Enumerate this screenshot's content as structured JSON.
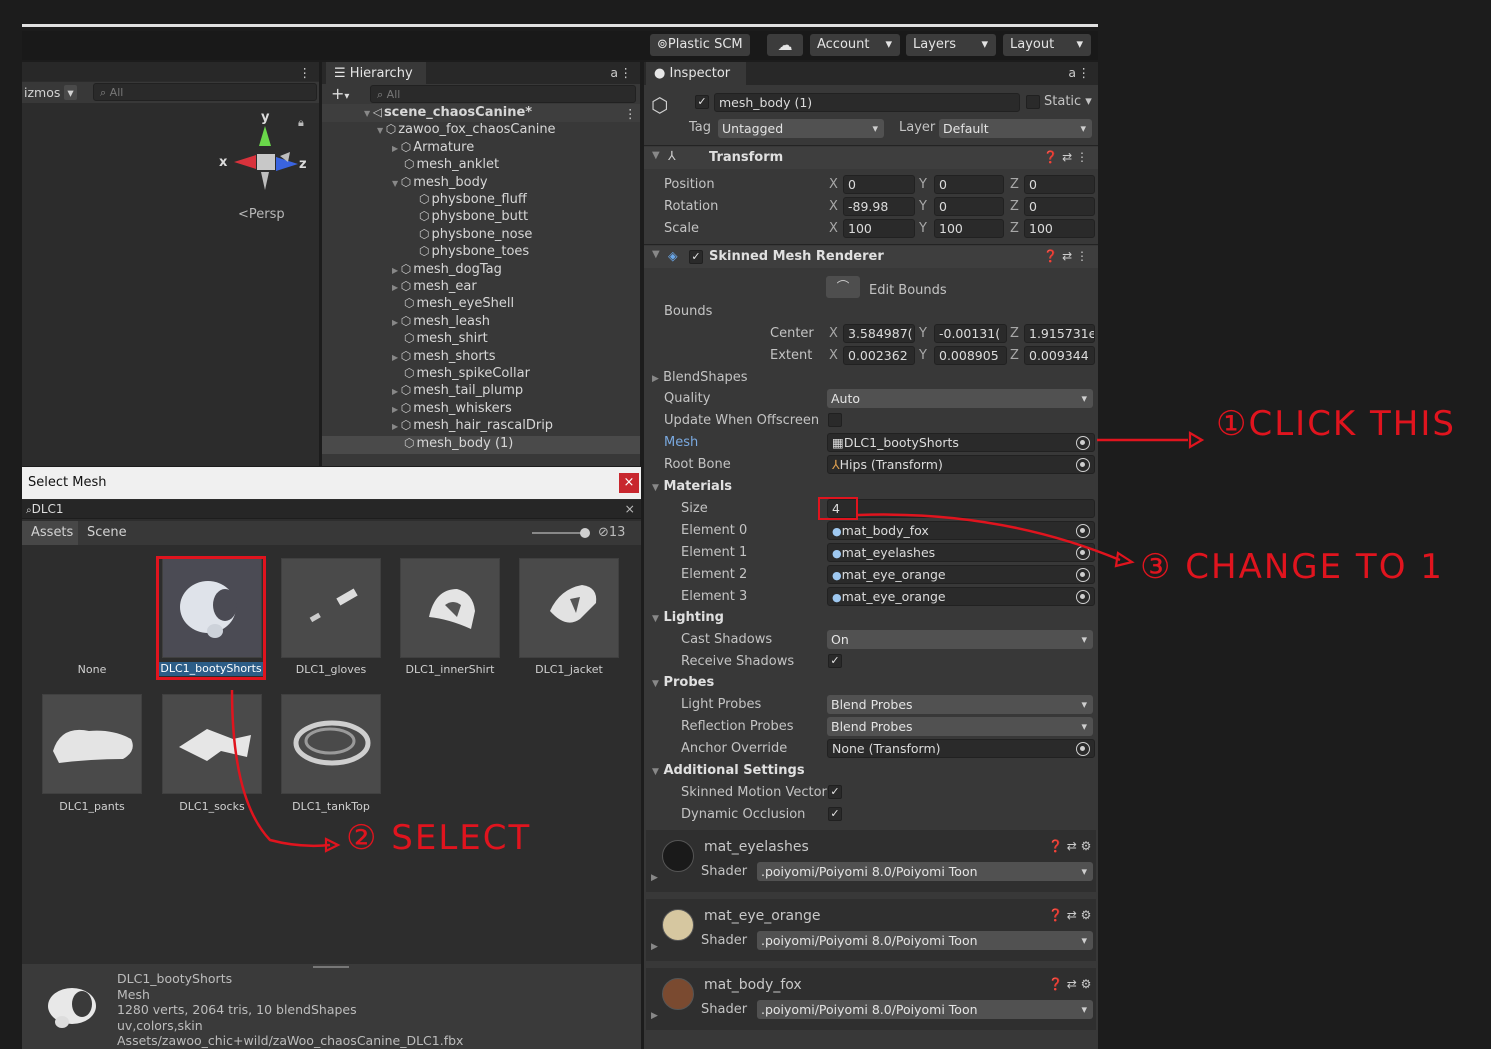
{
  "toolbar": {
    "plastic_scm": "⊚Plastic SCM",
    "account": "Account",
    "layers": "Layers",
    "layout": "Layout"
  },
  "scene_panel": {
    "gizmos_label": "izmos",
    "search_placeholder": "All",
    "axes": {
      "x": "x",
      "y": "y",
      "z": "z"
    },
    "persp": "Persp"
  },
  "hierarchy": {
    "tab_title": "Hierarchy",
    "search_placeholder": "All",
    "add_button": "+",
    "items": [
      {
        "label": "scene_chaosCanine*",
        "type": "scene"
      },
      {
        "label": "zawoo_fox_chaosCanine",
        "type": "object"
      },
      {
        "label": "Armature",
        "type": "object"
      },
      {
        "label": "mesh_anklet",
        "type": "object"
      },
      {
        "label": "mesh_body",
        "type": "object"
      },
      {
        "label": "physbone_fluff",
        "type": "object"
      },
      {
        "label": "physbone_butt",
        "type": "object"
      },
      {
        "label": "physbone_nose",
        "type": "object"
      },
      {
        "label": "physbone_toes",
        "type": "object"
      },
      {
        "label": "mesh_dogTag",
        "type": "object"
      },
      {
        "label": "mesh_ear",
        "type": "object"
      },
      {
        "label": "mesh_eyeShell",
        "type": "object"
      },
      {
        "label": "mesh_leash",
        "type": "object"
      },
      {
        "label": "mesh_shirt",
        "type": "object"
      },
      {
        "label": "mesh_shorts",
        "type": "object"
      },
      {
        "label": "mesh_spikeCollar",
        "type": "object"
      },
      {
        "label": "mesh_tail_plump",
        "type": "object"
      },
      {
        "label": "mesh_whiskers",
        "type": "object"
      },
      {
        "label": "mesh_hair_rascalDrip",
        "type": "object"
      },
      {
        "label": "mesh_body (1)",
        "type": "object"
      }
    ]
  },
  "select_mesh": {
    "title": "Select Mesh",
    "close": "×",
    "search_value": "DLC1",
    "clear": "×",
    "tabs": [
      "Assets",
      "Scene"
    ],
    "count": "13",
    "items": [
      "None",
      "DLC1_bootyShorts",
      "DLC1_gloves",
      "DLC1_innerShirt",
      "DLC1_jacket",
      "DLC1_pants",
      "DLC1_socks",
      "DLC1_tankTop"
    ],
    "selected": "DLC1_bootyShorts",
    "preview": {
      "name": "DLC1_bootyShorts",
      "kind": "Mesh",
      "stats": "1280 verts, 2064 tris, 10 blendShapes",
      "channels": "uv,colors,skin",
      "path": "Assets/zawoo_chic+wild/zaWoo_chaosCanine_DLC1.fbx"
    }
  },
  "inspector": {
    "tab_title": "Inspector",
    "object_name": "mesh_body (1)",
    "static_label": "Static",
    "tag_label": "Tag",
    "tag_value": "Untagged",
    "layer_label": "Layer",
    "layer_value": "Default",
    "transform": {
      "title": "Transform",
      "rows": [
        {
          "label": "Position",
          "x": "0",
          "y": "0",
          "z": "0"
        },
        {
          "label": "Rotation",
          "x": "-89.98",
          "y": "0",
          "z": "0"
        },
        {
          "label": "Scale",
          "x": "100",
          "y": "100",
          "z": "100"
        }
      ]
    },
    "smr": {
      "title": "Skinned Mesh Renderer",
      "edit_bounds": "Edit Bounds",
      "bounds_label": "Bounds",
      "center_label": "Center",
      "center": {
        "x": "3.584987(",
        "y": "-0.00131(",
        "z": "1.915731e"
      },
      "extent_label": "Extent",
      "extent": {
        "x": "0.002362",
        "y": "0.008905",
        "z": "0.009344"
      },
      "blendshapes": "BlendShapes",
      "quality_label": "Quality",
      "quality_value": "Auto",
      "update_offscreen": "Update When Offscreen",
      "mesh_label": "Mesh",
      "mesh_value": "DLC1_bootyShorts",
      "rootbone_label": "Root Bone",
      "rootbone_value": "Hips (Transform)",
      "materials": "Materials",
      "size_label": "Size",
      "size_value": "4",
      "elements": [
        {
          "label": "Element 0",
          "value": "mat_body_fox"
        },
        {
          "label": "Element 1",
          "value": "mat_eyelashes"
        },
        {
          "label": "Element 2",
          "value": "mat_eye_orange"
        },
        {
          "label": "Element 3",
          "value": "mat_eye_orange"
        }
      ],
      "lighting": "Lighting",
      "cast_shadows_label": "Cast Shadows",
      "cast_shadows_value": "On",
      "receive_shadows_label": "Receive Shadows",
      "probes": "Probes",
      "light_probes_label": "Light Probes",
      "light_probes_value": "Blend Probes",
      "reflection_probes_label": "Reflection Probes",
      "reflection_probes_value": "Blend Probes",
      "anchor_label": "Anchor Override",
      "anchor_value": "None (Transform)",
      "additional": "Additional Settings",
      "skinned_motion": "Skinned Motion Vector",
      "dynamic_occlusion": "Dynamic Occlusion"
    },
    "materials_list": [
      {
        "name": "mat_eyelashes",
        "shader_label": "Shader",
        "shader": ".poiyomi/Poiyomi 8.0/Poiyomi Toon"
      },
      {
        "name": "mat_eye_orange",
        "shader_label": "Shader",
        "shader": ".poiyomi/Poiyomi 8.0/Poiyomi Toon"
      },
      {
        "name": "mat_body_fox",
        "shader_label": "Shader",
        "shader": ".poiyomi/Poiyomi 8.0/Poiyomi Toon"
      }
    ]
  },
  "annotations": {
    "step1": "①CLICK THIS",
    "step2": "② SELECT",
    "step3": "③ CHANGE TO 1",
    "color": "#e0141e"
  }
}
